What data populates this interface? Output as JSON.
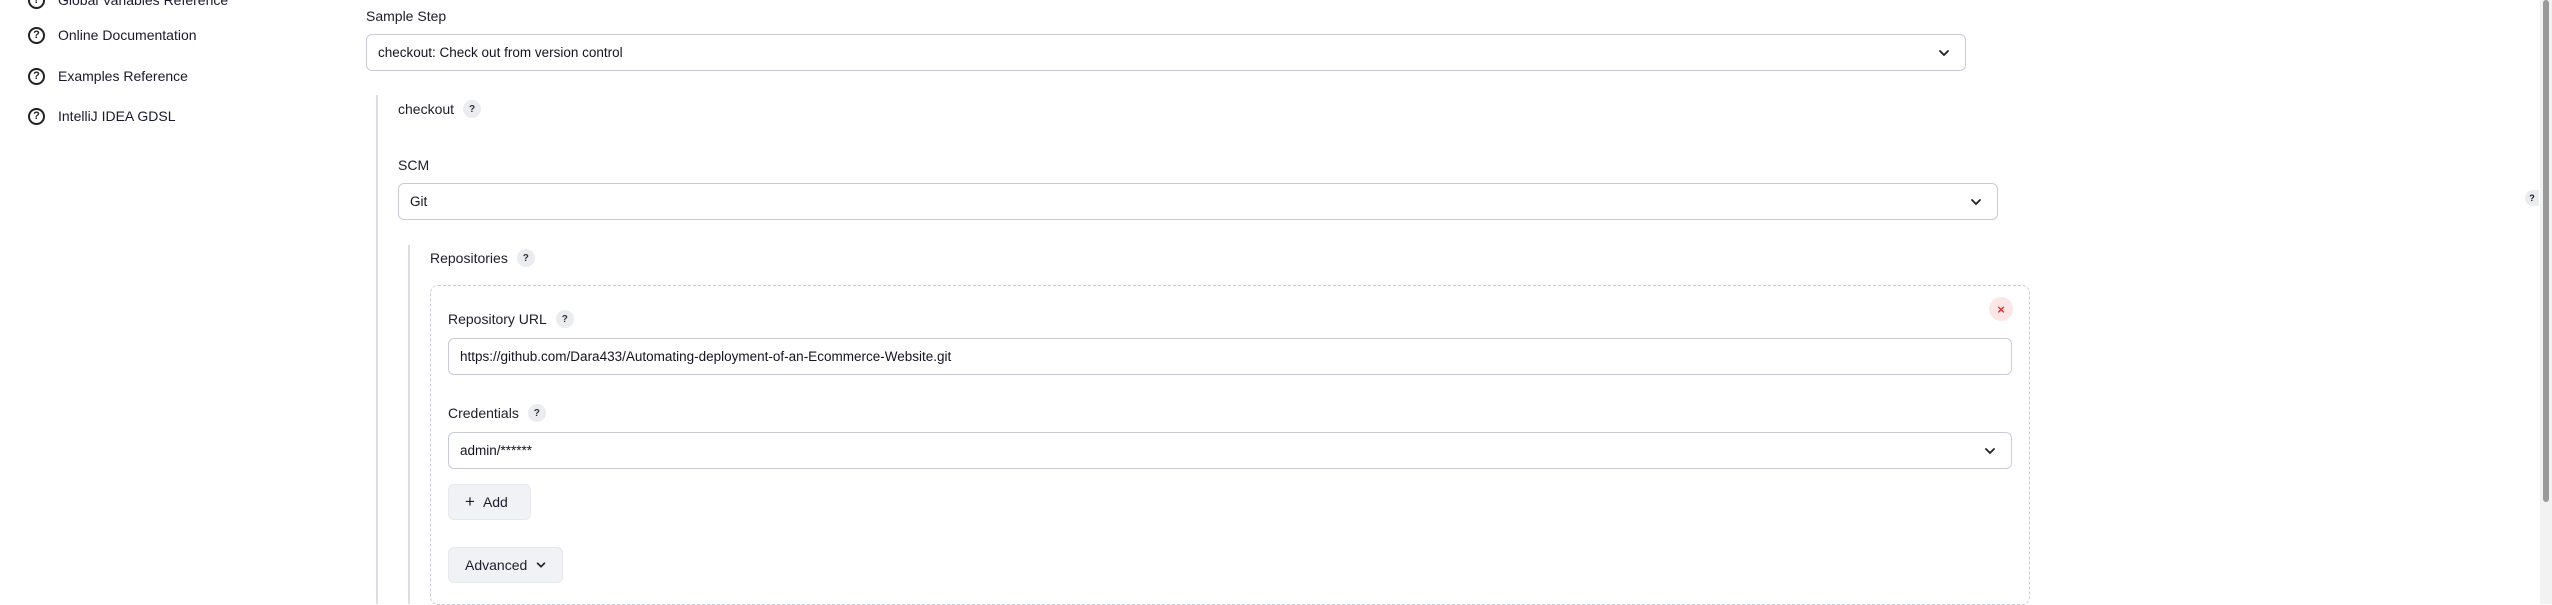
{
  "sidebar": {
    "items": [
      {
        "label": "Global Variables Reference",
        "icon": "help-circle-icon"
      },
      {
        "label": "Online Documentation",
        "icon": "help-circle-icon"
      },
      {
        "label": "Examples Reference",
        "icon": "help-circle-icon"
      },
      {
        "label": "IntelliJ IDEA GDSL",
        "icon": "help-circle-icon"
      }
    ]
  },
  "sample_step": {
    "label": "Sample Step",
    "value": "checkout: Check out from version control"
  },
  "checkout": {
    "label": "checkout",
    "help": "?"
  },
  "scm": {
    "label": "SCM",
    "value": "Git"
  },
  "repositories": {
    "label": "Repositories",
    "help": "?"
  },
  "repository": {
    "url_label": "Repository URL",
    "url_help": "?",
    "url_value": "https://github.com/Dara433/Automating-deployment-of-an-Ecommerce-Website.git",
    "delete_label": "×",
    "credentials_label": "Credentials",
    "credentials_help": "?",
    "credentials_value": "admin/******",
    "add_label": "Add",
    "add_icon": "+",
    "advanced_label": "Advanced"
  },
  "edge_help": "?",
  "help_glyph": "?"
}
